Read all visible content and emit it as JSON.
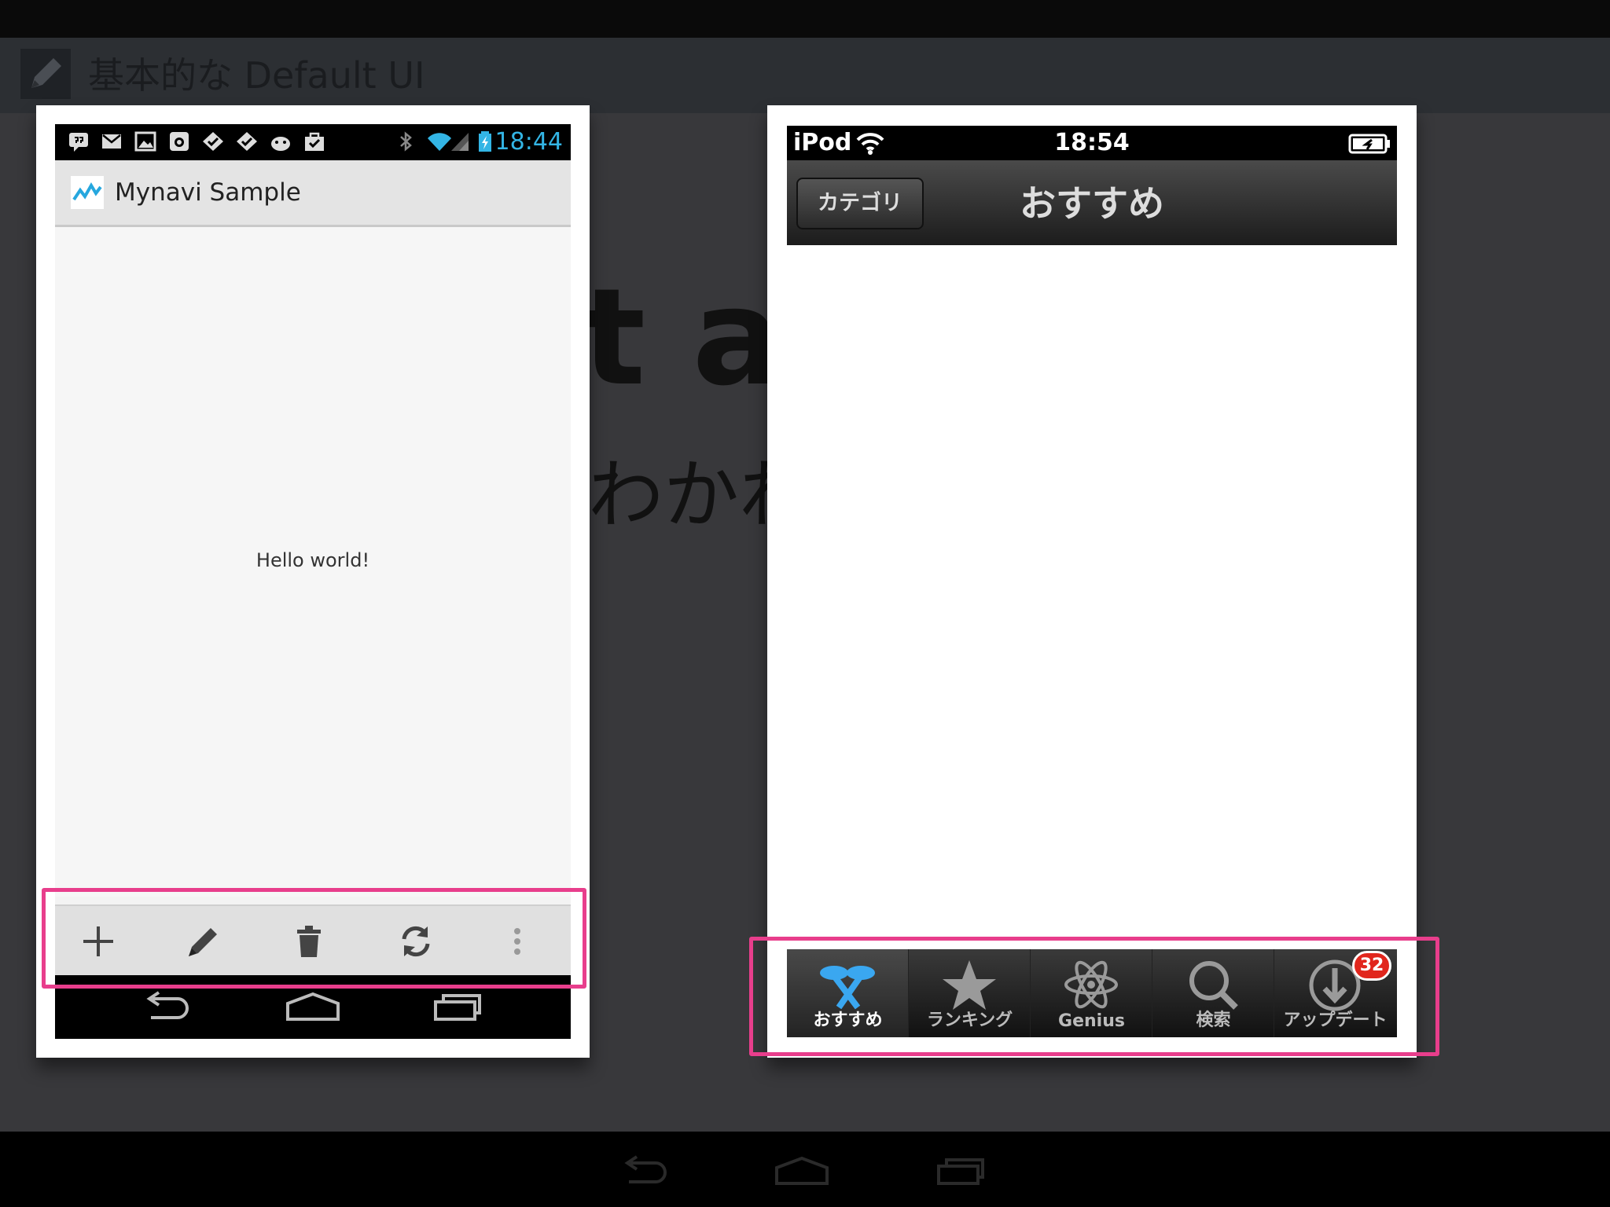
{
  "slide": {
    "title": "基本的な Default UI",
    "bg_heading": "t ac",
    "bg_subtext": "わかれ"
  },
  "android": {
    "status_time": "18:44",
    "app_title": "Mynavi Sample",
    "content_text": "Hello world!",
    "status_icons": [
      "hangouts-icon",
      "gmail-icon",
      "gallery-icon",
      "instagram-icon",
      "task-check-icon",
      "task-check-icon",
      "android-icon",
      "shopping-bag-icon"
    ],
    "toolbar_icons": [
      "add-icon",
      "edit-pencil-icon",
      "trash-icon",
      "refresh-icon",
      "overflow-menu-icon"
    ],
    "nav_icons": [
      "back-icon",
      "home-icon",
      "recent-apps-icon"
    ],
    "time_color": "#33b5e5"
  },
  "ios": {
    "carrier": "iPod",
    "status_time": "18:54",
    "back_button": "カテゴリ",
    "nav_title": "おすすめ",
    "tabs": [
      {
        "label": "おすすめ",
        "icon": "featured-icon",
        "active": true
      },
      {
        "label": "ランキング",
        "icon": "star-icon",
        "active": false
      },
      {
        "label": "Genius",
        "icon": "genius-atom-icon",
        "active": false
      },
      {
        "label": "検索",
        "icon": "search-icon",
        "active": false
      },
      {
        "label": "アップデート",
        "icon": "updates-download-icon",
        "active": false,
        "badge": "32"
      }
    ]
  },
  "highlight_color": "#e83e8c"
}
